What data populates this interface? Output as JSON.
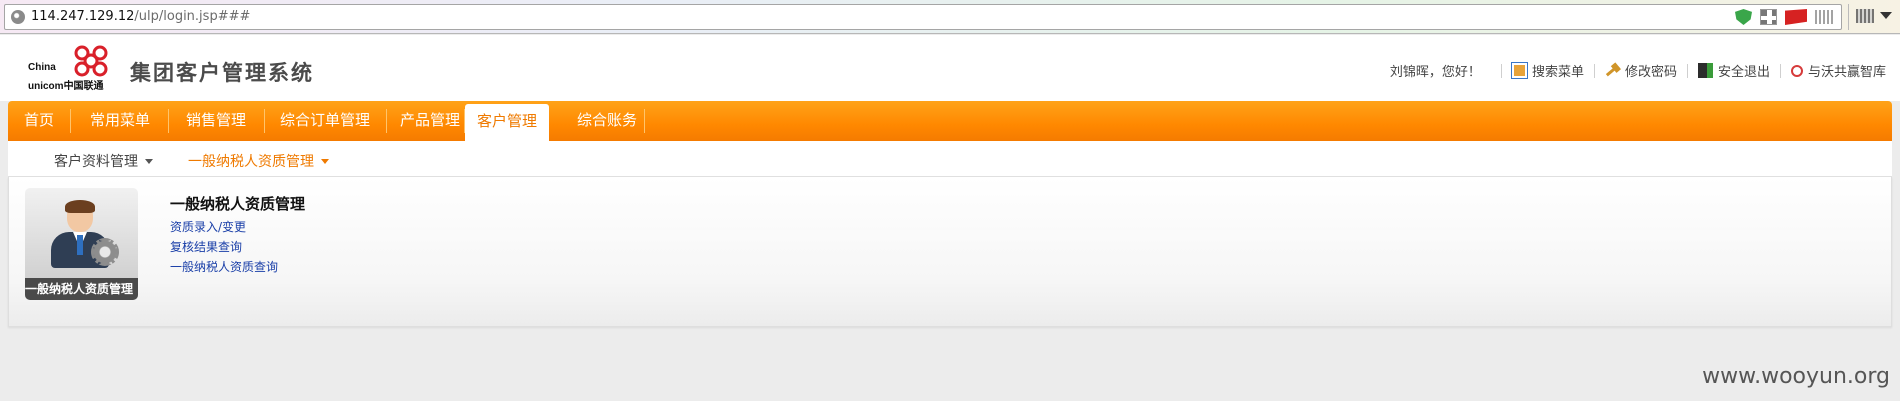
{
  "browser": {
    "url_host": "114.247.129.12",
    "url_path": "/ulp/login.jsp###"
  },
  "header": {
    "logo_en_top": "China",
    "logo_en_bottom": "unicom",
    "logo_cn": "中国联通",
    "system_title": "集团客户管理系统",
    "greeting": "刘锦晖，您好！",
    "links": [
      {
        "label": "搜索菜单",
        "icon": "menu-search-icon"
      },
      {
        "label": "修改密码",
        "icon": "key-icon"
      },
      {
        "label": "安全退出",
        "icon": "exit-icon"
      },
      {
        "label": "与沃共赢智库",
        "icon": "search-icon"
      }
    ]
  },
  "nav": {
    "items": [
      {
        "label": "首页"
      },
      {
        "label": "常用菜单"
      },
      {
        "label": "销售管理"
      },
      {
        "label": "综合订单管理"
      },
      {
        "label": "产品管理"
      },
      {
        "label": "客户管理",
        "active": true
      },
      {
        "label": "综合账务"
      }
    ],
    "accent": "#ff8c00"
  },
  "subnav": {
    "items": [
      {
        "label": "客户资料管理"
      },
      {
        "label": "一般纳税人资质管理",
        "active": true
      }
    ]
  },
  "content": {
    "tile_label": "一般纳税人资质管理",
    "section_title": "一般纳税人资质管理",
    "links": [
      "资质录入/变更",
      "复核结果查询",
      "一般纳税人资质查询"
    ]
  },
  "watermark": "www.wooyun.org"
}
